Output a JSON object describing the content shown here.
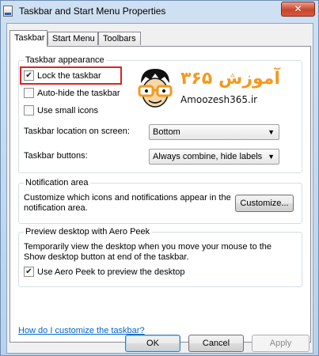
{
  "window": {
    "title": "Taskbar and Start Menu Properties",
    "close_label": "✕"
  },
  "tabs": [
    {
      "label": "Taskbar"
    },
    {
      "label": "Start Menu"
    },
    {
      "label": "Toolbars"
    }
  ],
  "taskbar_appearance": {
    "title": "Taskbar appearance",
    "lock_label": "Lock the taskbar",
    "autohide_label": "Auto-hide the taskbar",
    "small_icons_label": "Use small icons",
    "location_label": "Taskbar location on screen:",
    "location_value": "Bottom",
    "buttons_label": "Taskbar buttons:",
    "buttons_value": "Always combine, hide labels",
    "lock_checked": true,
    "autohide_checked": false,
    "small_icons_checked": false
  },
  "notification": {
    "title": "Notification area",
    "description": "Customize which icons and notifications appear in the notification area.",
    "customize_label": "Customize..."
  },
  "aero_peek": {
    "title": "Preview desktop with Aero Peek",
    "description": "Temporarily view the desktop when you move your mouse to the Show desktop button at end of the taskbar.",
    "use_label": "Use Aero Peek to preview the desktop",
    "use_checked": true
  },
  "help_link": "How do I customize the taskbar?",
  "footer": {
    "ok_label": "OK",
    "cancel_label": "Cancel",
    "apply_label": "Apply"
  },
  "watermark": {
    "persian_text": "آموزش ۳۶۵",
    "latin_text": "Amoozesh365.ir"
  },
  "colors": {
    "highlight": "#e02020",
    "link": "#0066cc",
    "logo_orange": "#f39a1e"
  }
}
